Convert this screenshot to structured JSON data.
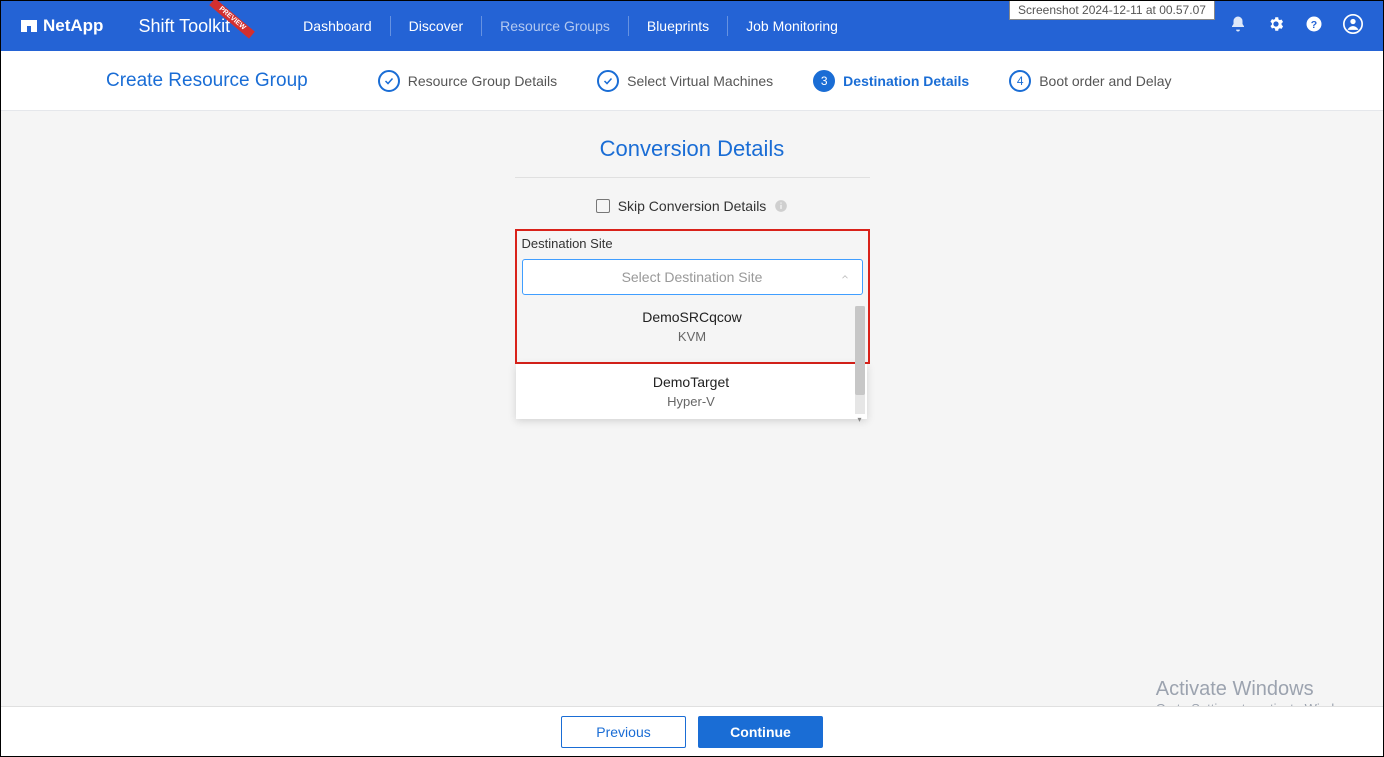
{
  "screenshot_label": "Screenshot 2024-12-11 at 00.57.07",
  "brand": "NetApp",
  "app_name": "Shift Toolkit",
  "preview_badge": "PREVIEW",
  "nav": {
    "dashboard": "Dashboard",
    "discover": "Discover",
    "resource_groups": "Resource Groups",
    "blueprints": "Blueprints",
    "job_monitoring": "Job Monitoring"
  },
  "wizard": {
    "title": "Create Resource Group",
    "steps": {
      "s1": "Resource Group Details",
      "s2": "Select Virtual Machines",
      "s3": "Destination Details",
      "s3_num": "3",
      "s4": "Boot order and Delay",
      "s4_num": "4"
    }
  },
  "panel": {
    "title": "Conversion Details",
    "skip_label": "Skip Conversion Details",
    "dest_label": "Destination Site",
    "dest_placeholder": "Select Destination Site",
    "options": [
      {
        "name": "DemoSRCqcow",
        "sub": "KVM"
      },
      {
        "name": "DemoTarget",
        "sub": "Hyper-V"
      }
    ]
  },
  "footer": {
    "previous": "Previous",
    "continue": "Continue"
  },
  "watermark": {
    "title": "Activate Windows",
    "sub": "Go to Settings to activate Windows."
  }
}
